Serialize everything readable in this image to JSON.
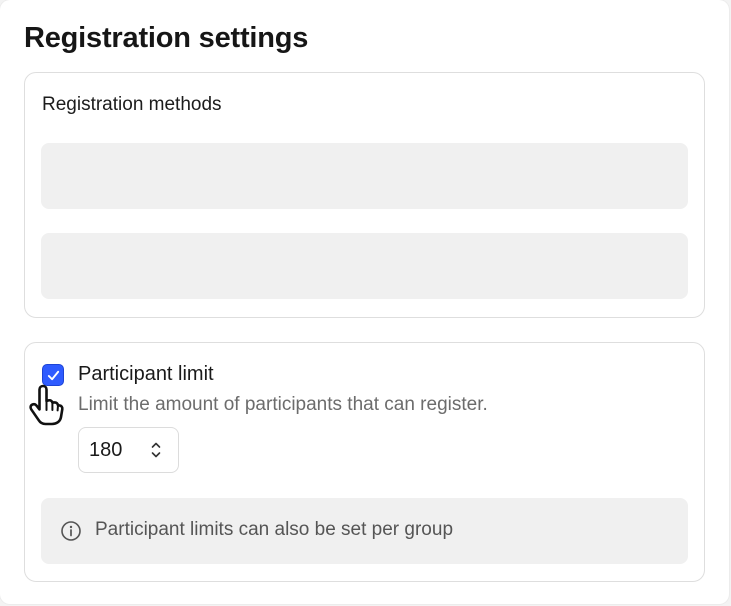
{
  "page": {
    "title": "Registration settings"
  },
  "registration_methods": {
    "heading": "Registration methods",
    "options_loading": 2
  },
  "participant_limit": {
    "checkbox_checked": true,
    "label": "Participant limit",
    "description": "Limit the amount of participants that can register.",
    "value": "180",
    "info": "Participant limits can also be set per group"
  },
  "icons": {
    "checkbox": "checkmark-icon",
    "stepper": "chevron-up-down-icon",
    "info": "info-icon",
    "cursor": "hand-pointer-cursor"
  },
  "colors": {
    "accent": "#2e5bff",
    "placeholder": "#f0f0f0",
    "border": "#dedede"
  }
}
